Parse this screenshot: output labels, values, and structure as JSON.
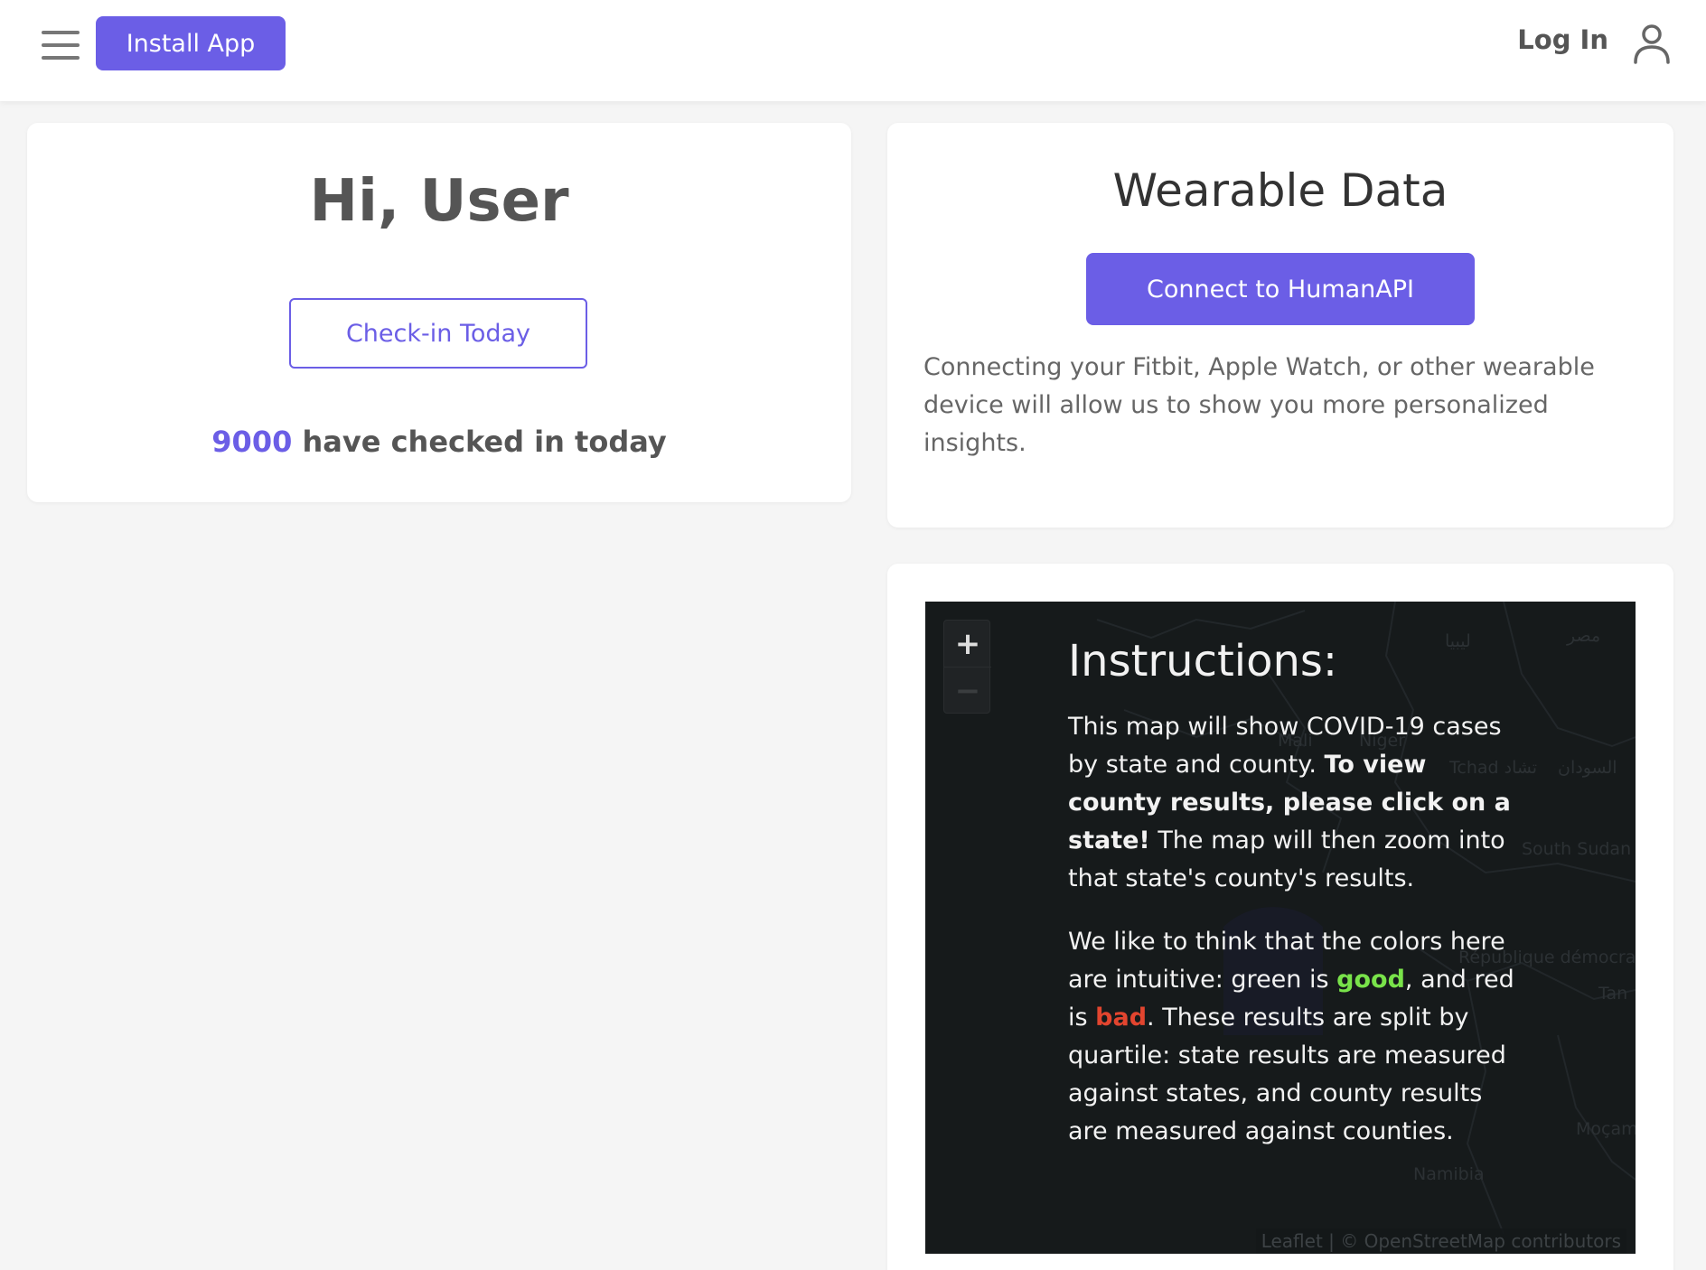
{
  "header": {
    "install_label": "Install App",
    "login_label": "Log In"
  },
  "greeting": {
    "title": "Hi, User",
    "checkin_label": "Check-in Today",
    "checked_count": "9000",
    "checked_suffix": "have checked in today"
  },
  "wearable": {
    "title": "Wearable Data",
    "connect_label": "Connect to HumanAPI",
    "description": "Connecting your Fitbit, Apple Watch, or other wearable device will allow us to show you more personalized insights."
  },
  "map": {
    "zoom_in": "+",
    "zoom_out": "−",
    "labels": [
      "ليبيا",
      "مصر",
      "Mali",
      "Niger",
      "Tchad تشاد",
      "السودان",
      "South Sudan",
      "République démocratique du Congo",
      "Tan",
      "Moçam",
      "Namibia"
    ],
    "instructions": {
      "title": "Instructions:",
      "p1_a": "This map will show COVID-19 cases by state and county. ",
      "p1_bold": "To view county results, please click on a state!",
      "p1_b": " The map will then zoom into that state's county's results.",
      "p2_a": "We like to think that the colors here are intuitive: green is ",
      "p2_good": "good",
      "p2_b": ", and red is ",
      "p2_bad": "bad",
      "p2_c": ". These results are split by quartile: state results are measured against states, and county results are measured against counties."
    },
    "attribution": {
      "leaflet": "Leaflet",
      "sep": " | © ",
      "osm": "OpenStreetMap",
      "contrib": " contributors"
    }
  },
  "colors": {
    "accent": "#6b5ee6",
    "good": "#79e34a",
    "bad": "#e2452f",
    "map_bg": "#161a1b"
  }
}
